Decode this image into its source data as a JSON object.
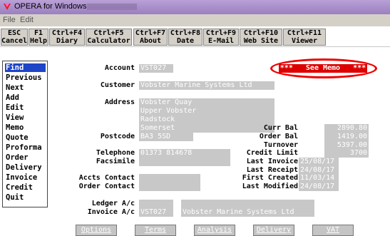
{
  "window": {
    "title": "OPERA for Windows"
  },
  "menu": [
    "File",
    "Edit"
  ],
  "toolbar": [
    {
      "key": "ESC",
      "label": "Cancel"
    },
    {
      "key": "F1",
      "label": "Help"
    },
    {
      "key": "Ctrl+F4",
      "label": "Diary"
    },
    {
      "key": "Ctrl+F5",
      "label": "Calculator"
    },
    {
      "key": "Ctrl+F7",
      "label": "About"
    },
    {
      "key": "Ctrl+F8",
      "label": "Date"
    },
    {
      "key": "Ctrl+F9",
      "label": "E-Mail"
    },
    {
      "key": "Ctrl+F10",
      "label": "Web Site"
    },
    {
      "key": "Ctrl+F11",
      "label": "Viewer"
    }
  ],
  "nav": [
    "Find",
    "Previous",
    "Next",
    "Add",
    "Edit",
    "View",
    "Memo",
    "Quote",
    "Proforma",
    "Order",
    "Delivery",
    "Invoice",
    "Credit",
    "Quit"
  ],
  "memo": {
    "text": "***   See Memo   ***"
  },
  "labels": {
    "account": "Account",
    "customer": "Customer",
    "address": "Address",
    "postcode": "Postcode",
    "telephone": "Telephone",
    "facsimile": "Facsimile",
    "accts_contact": "Accts Contact",
    "order_contact": "Order Contact",
    "ledger_ac": "Ledger A/c",
    "invoice_ac": "Invoice A/c",
    "curr_bal": "Curr Bal",
    "order_bal": "Order Bal",
    "turnover": "Turnover",
    "credit_limit": "Credit Limit",
    "last_invoice": "Last Invoice",
    "last_receipt": "Last Receipt",
    "first_created": "First Created",
    "last_modified": "Last Modified"
  },
  "values": {
    "account": "VST027",
    "customer": "Vobster Marine Systems Ltd",
    "address": [
      "Vobster Quay",
      "Upper Vobster",
      "Radstock",
      "Somerset"
    ],
    "postcode": "BA3 5SD",
    "telephone": "01373 814678",
    "facsimile": "",
    "accts_contact": "",
    "order_contact": "",
    "ledger_ac": "",
    "invoice_ac_code": "VST027",
    "invoice_ac_name": "Vobster Marine Systems Ltd",
    "curr_bal": "2890.80",
    "order_bal": "1419.00",
    "turnover": "5397.00",
    "credit_limit": "3700",
    "last_invoice": "25/08/17",
    "last_receipt": "24/08/17",
    "first_created": "11/03/14",
    "last_modified": "24/08/17"
  },
  "buttons": [
    "Options",
    "Terms",
    "Analysis",
    "Delivery",
    "VAT"
  ],
  "colors": {
    "titlebar": "#a58bc8",
    "nav_selected": "#1e44c8",
    "memo": "#dd0000",
    "field": "#c8c8c8"
  }
}
